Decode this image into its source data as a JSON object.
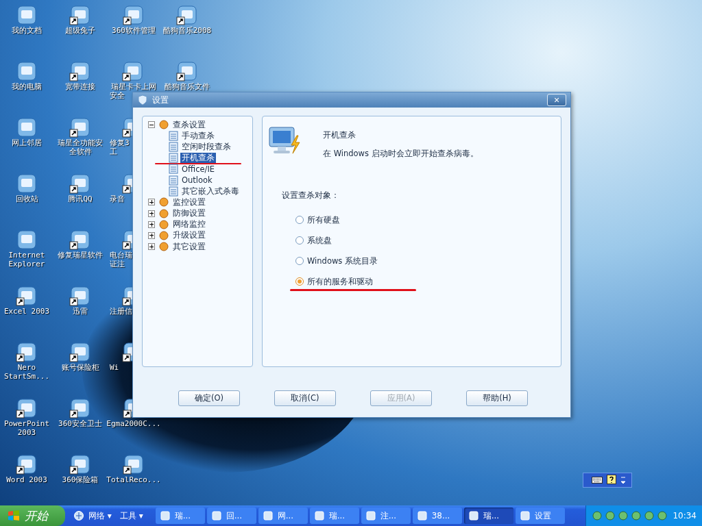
{
  "desktop": {
    "icon_columns": [
      [
        {
          "lines": [
            {
              "text": "我的文档",
              "clipped": false
            }
          ],
          "shortcut": false
        },
        {
          "lines": [
            {
              "text": "我的电脑",
              "clipped": false
            }
          ],
          "shortcut": false
        },
        {
          "lines": [
            {
              "text": "网上邻居",
              "clipped": false
            }
          ],
          "shortcut": false
        },
        {
          "lines": [
            {
              "text": "回收站",
              "clipped": false
            }
          ],
          "shortcut": false
        },
        {
          "lines": [
            {
              "text": "Internet",
              "clipped": false
            },
            {
              "text": "Explorer",
              "clipped": false
            }
          ],
          "shortcut": false
        },
        {
          "lines": [
            {
              "text": "Excel 2003",
              "clipped": false
            }
          ],
          "shortcut": true
        },
        {
          "lines": [
            {
              "text": "Nero",
              "clipped": false
            },
            {
              "text": "StartSm...",
              "clipped": false
            }
          ],
          "shortcut": true
        },
        {
          "lines": [
            {
              "text": "PowerPoint",
              "clipped": false
            },
            {
              "text": "2003",
              "clipped": false
            }
          ],
          "shortcut": true
        },
        {
          "lines": [
            {
              "text": "Word 2003",
              "clipped": false
            }
          ],
          "shortcut": true
        }
      ],
      [
        {
          "lines": [
            {
              "text": "超级兔子",
              "clipped": false
            }
          ],
          "shortcut": true
        },
        {
          "lines": [
            {
              "text": "宽带连接",
              "clipped": false
            }
          ],
          "shortcut": true
        },
        {
          "lines": [
            {
              "text": "瑞星全功能安",
              "clipped": false
            },
            {
              "text": "全软件",
              "clipped": false
            }
          ],
          "shortcut": true
        },
        {
          "lines": [
            {
              "text": "腾讯QQ",
              "clipped": false
            }
          ],
          "shortcut": true
        },
        {
          "lines": [
            {
              "text": "修复瑞星软件",
              "clipped": false
            }
          ],
          "shortcut": true
        },
        {
          "lines": [
            {
              "text": "迅雷",
              "clipped": false
            }
          ],
          "shortcut": true
        },
        {
          "lines": [
            {
              "text": "账号保险柜",
              "clipped": false
            }
          ],
          "shortcut": true
        },
        {
          "lines": [
            {
              "text": "360安全卫士",
              "clipped": false
            }
          ],
          "shortcut": true
        },
        {
          "lines": [
            {
              "text": "360保险箱",
              "clipped": false
            }
          ],
          "shortcut": true
        }
      ],
      [
        {
          "lines": [
            {
              "text": "360软件管理",
              "clipped": false
            }
          ],
          "shortcut": true
        },
        {
          "lines": [
            {
              "text": "瑞星卡卡上网",
              "clipped": false
            },
            {
              "text": "安全",
              "clipped": true
            }
          ],
          "shortcut": true
        },
        {
          "lines": [
            {
              "text": "修复3",
              "clipped": true
            },
            {
              "text": "工",
              "clipped": true
            }
          ],
          "shortcut": true
        },
        {
          "lines": [
            {
              "text": "录音",
              "clipped": true
            }
          ],
          "shortcut": true
        },
        {
          "lines": [
            {
              "text": "电台瑞",
              "clipped": true
            },
            {
              "text": "证注",
              "clipped": true
            }
          ],
          "shortcut": true
        },
        {
          "lines": [
            {
              "text": "注册信",
              "clipped": true
            }
          ],
          "shortcut": true
        },
        {
          "lines": [
            {
              "text": "Wi",
              "clipped": true
            }
          ],
          "shortcut": true
        },
        {
          "lines": [
            {
              "text": "Egma2000C...",
              "clipped": false
            }
          ],
          "shortcut": true
        },
        {
          "lines": [
            {
              "text": "TotalReco...",
              "clipped": false
            }
          ],
          "shortcut": true
        }
      ],
      [
        {
          "lines": [
            {
              "text": "酷狗音乐2008",
              "clipped": false
            }
          ],
          "shortcut": true
        },
        {
          "lines": [
            {
              "text": "酷狗音乐文件",
              "clipped": false
            }
          ],
          "shortcut": true
        }
      ]
    ]
  },
  "dialog": {
    "title": "设置",
    "close": "×",
    "tree": [
      {
        "label": "查杀设置",
        "expanded": true,
        "children": [
          {
            "label": "手动查杀",
            "selected": false,
            "marked": false
          },
          {
            "label": "空闲时段查杀",
            "selected": false,
            "marked": false
          },
          {
            "label": "开机查杀",
            "selected": true,
            "marked": true
          },
          {
            "label": "Office/IE",
            "selected": false,
            "marked": false
          },
          {
            "label": "Outlook",
            "selected": false,
            "marked": false
          },
          {
            "label": "其它嵌入式杀毒",
            "selected": false,
            "marked": false
          }
        ]
      },
      {
        "label": "监控设置",
        "expanded": false
      },
      {
        "label": "防御设置",
        "expanded": false
      },
      {
        "label": "网络监控",
        "expanded": false
      },
      {
        "label": "升级设置",
        "expanded": false
      },
      {
        "label": "其它设置",
        "expanded": false
      }
    ],
    "heading": "开机查杀",
    "description": "在 Windows 启动时会立即开始查杀病毒。",
    "group_label": "设置查杀对象：",
    "options": [
      {
        "label": "所有硬盘",
        "selected": false,
        "marked": false
      },
      {
        "label": "系统盘",
        "selected": false,
        "marked": false
      },
      {
        "label": "Windows 系统目录",
        "selected": false,
        "marked": false
      },
      {
        "label": "所有的服务和驱动",
        "selected": true,
        "marked": true
      }
    ],
    "buttons": [
      {
        "label": "确定(O)",
        "disabled": false
      },
      {
        "label": "取消(C)",
        "disabled": false
      },
      {
        "label": "应用(A)",
        "disabled": true
      },
      {
        "label": "帮助(H)",
        "disabled": false
      }
    ]
  },
  "taskbar": {
    "start": "开始",
    "toolbars": [
      {
        "label": "网络",
        "arrow": "▾"
      },
      {
        "label": "工具",
        "arrow": "▾"
      }
    ],
    "tasks": [
      {
        "label": "瑞...",
        "selected": false
      },
      {
        "label": "回...",
        "selected": false
      },
      {
        "label": "网...",
        "selected": false
      },
      {
        "label": "瑞...",
        "selected": false
      },
      {
        "label": "注...",
        "selected": false
      },
      {
        "label": "38...",
        "selected": false
      },
      {
        "label": "瑞...",
        "selected": true
      },
      {
        "label": "设置",
        "selected": false
      }
    ],
    "clock": "10:34"
  }
}
